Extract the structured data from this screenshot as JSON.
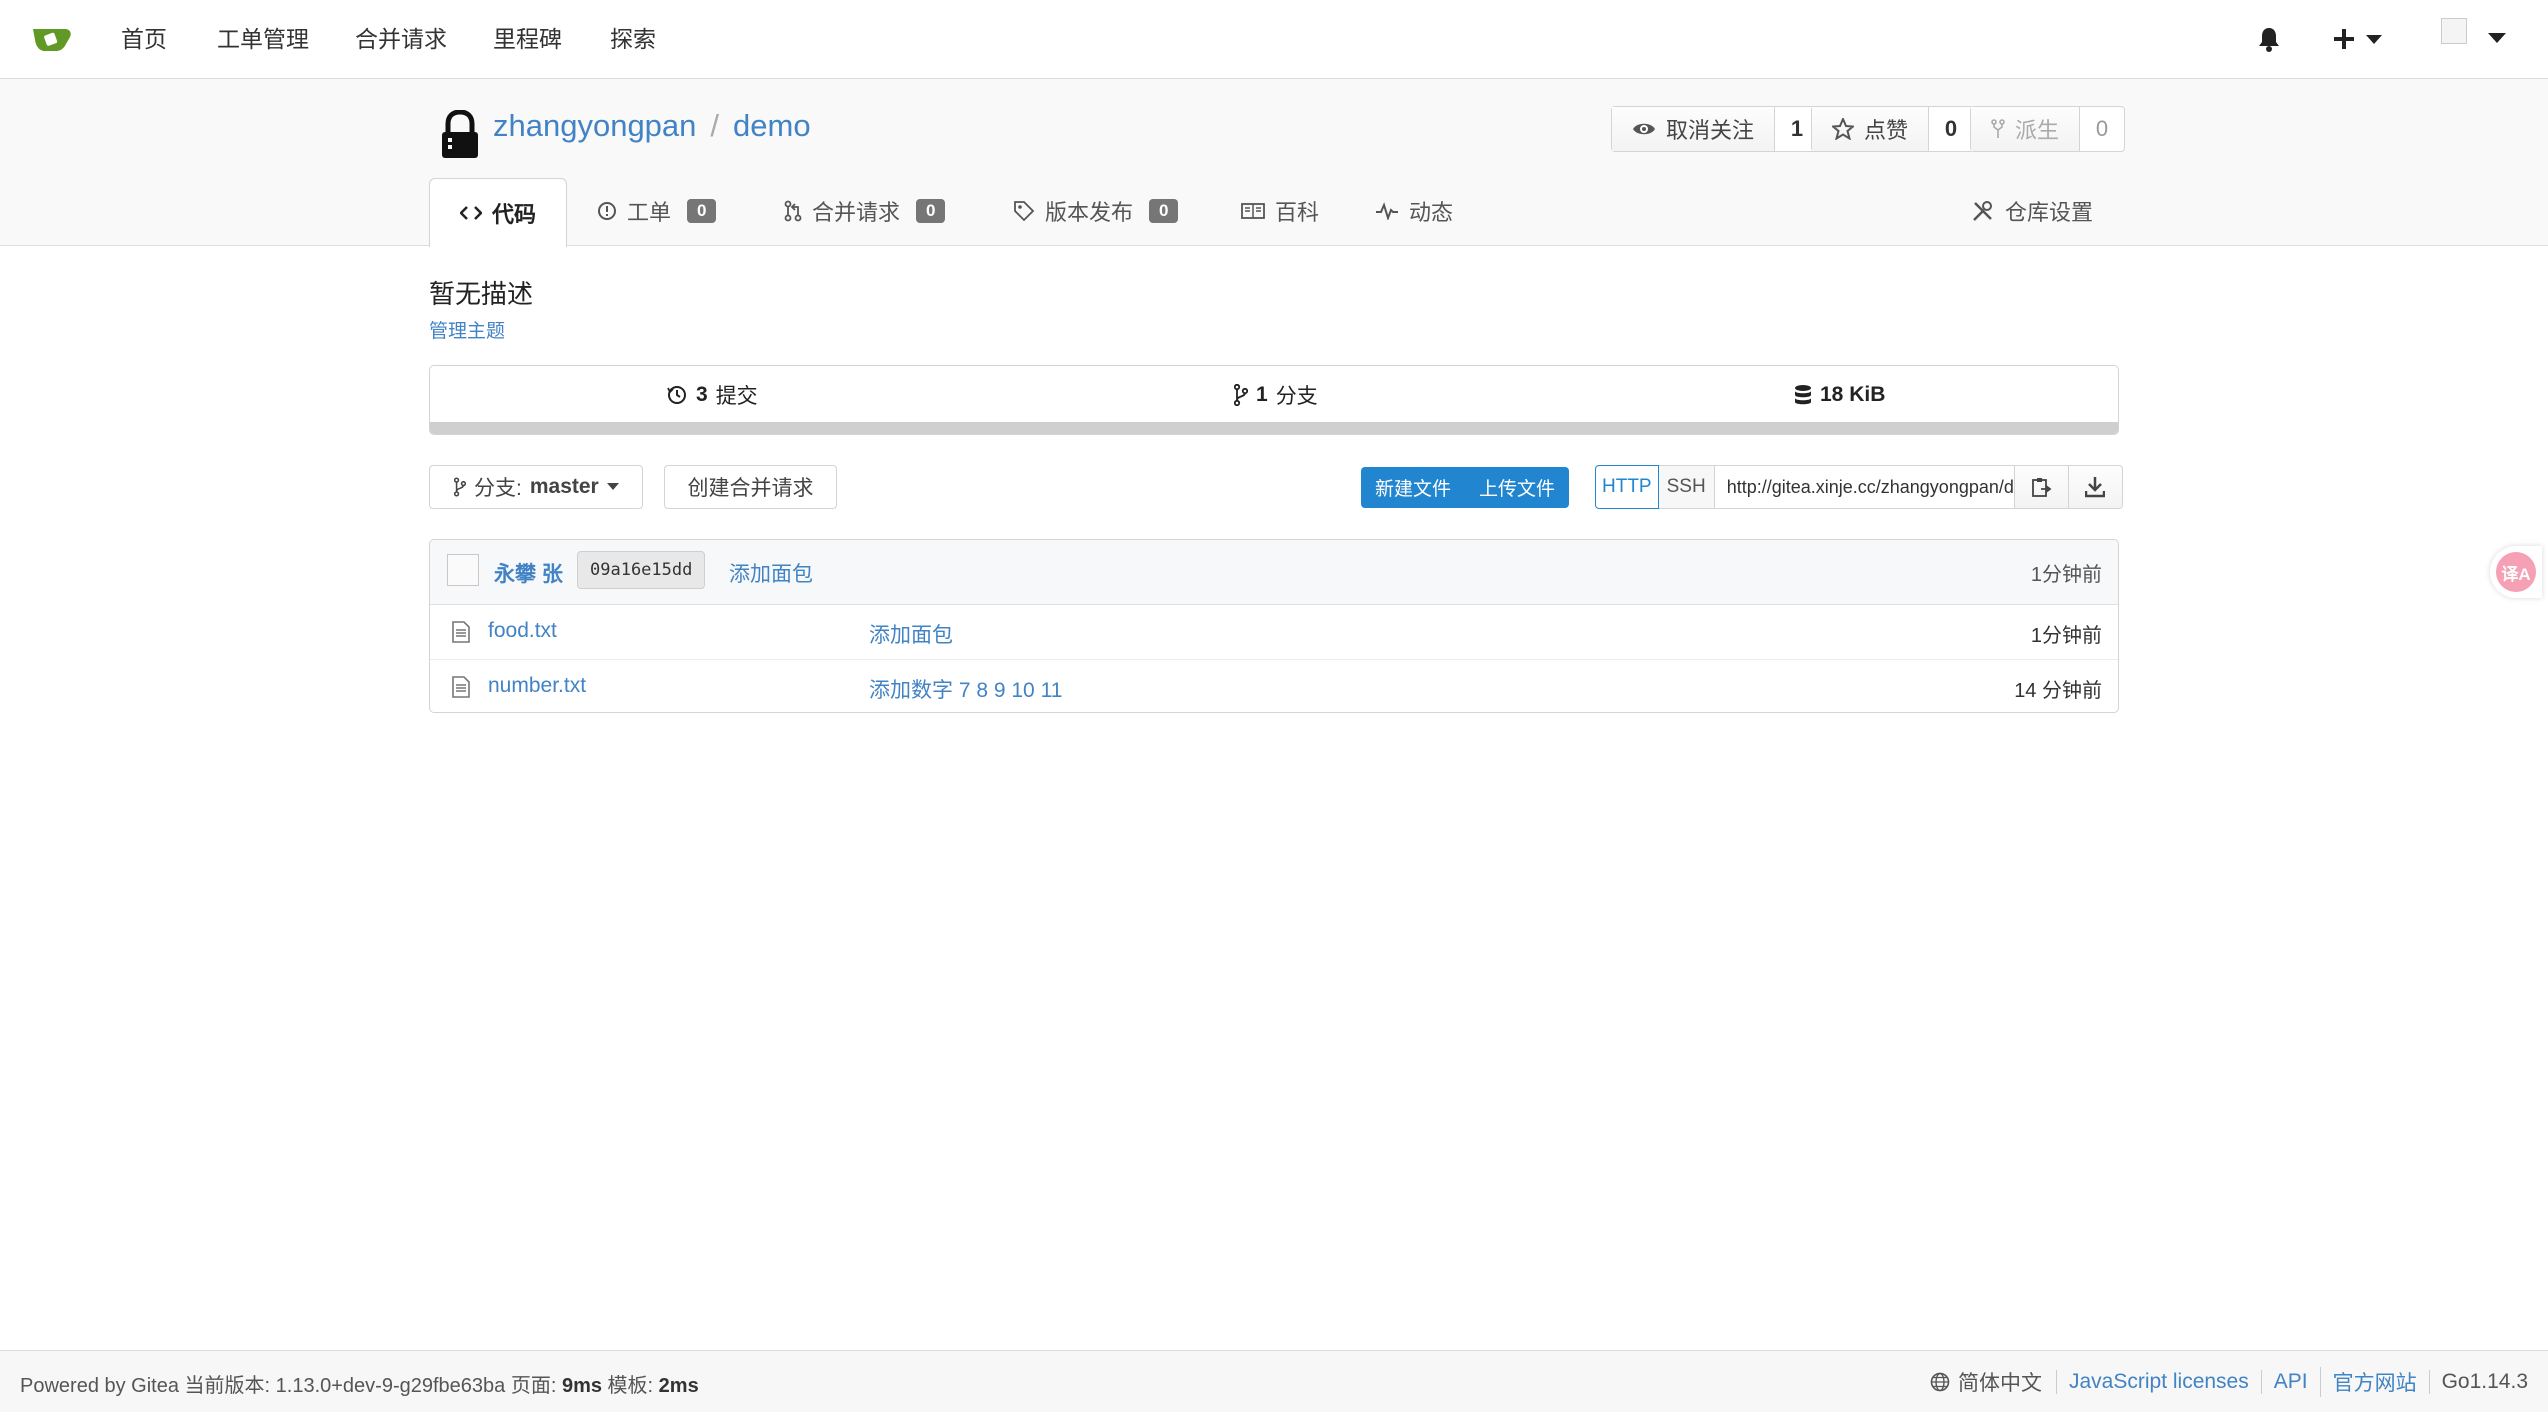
{
  "nav": {
    "items": [
      "首页",
      "工单管理",
      "合并请求",
      "里程碑",
      "探索"
    ]
  },
  "repo": {
    "owner": "zhangyongpan",
    "separator": "/",
    "name": "demo",
    "watch_label": "取消关注",
    "watch_count": "1",
    "star_label": "点赞",
    "star_count": "0",
    "fork_label": "派生",
    "fork_count": "0"
  },
  "tabs": {
    "code": "代码",
    "issues": "工单",
    "issues_count": "0",
    "pulls": "合并请求",
    "pulls_count": "0",
    "releases": "版本发布",
    "releases_count": "0",
    "wiki": "百科",
    "activity": "动态",
    "settings": "仓库设置"
  },
  "description": "暂无描述",
  "manage_topics": "管理主题",
  "stats": {
    "commits_num": "3",
    "commits_label": "提交",
    "branches_num": "1",
    "branches_label": "分支",
    "size": "18 KiB"
  },
  "toolbar": {
    "branch_prefix": "分支:",
    "branch_name": "master",
    "create_pr": "创建合并请求",
    "new_file": "新建文件",
    "upload_file": "上传文件",
    "http": "HTTP",
    "ssh": "SSH",
    "clone_url": "http://gitea.xinje.cc/zhangyongpan/demo.git"
  },
  "latest_commit": {
    "author": "永攀 张",
    "sha": "09a16e15dd",
    "message": "添加面包",
    "time": "1分钟前"
  },
  "files": [
    {
      "name": "food.txt",
      "message": "添加面包",
      "time": "1分钟前"
    },
    {
      "name": "number.txt",
      "message": "添加数字 7 8 9 10 11",
      "time": "14 分钟前"
    }
  ],
  "translate_badge": "译A",
  "footer": {
    "powered": "Powered by Gitea 当前版本: 1.13.0+dev-9-g29fbe63ba 页面: ",
    "page_time": "9ms",
    "tmpl_label": " 模板: ",
    "tmpl_time": "2ms",
    "language": "简体中文",
    "js_licenses": "JavaScript licenses",
    "api": "API",
    "website": "官方网站",
    "go_version": "Go1.14.3"
  },
  "colors": {
    "accent": "#4183c4",
    "primary_button": "#2185d0",
    "badge": "#767676"
  }
}
